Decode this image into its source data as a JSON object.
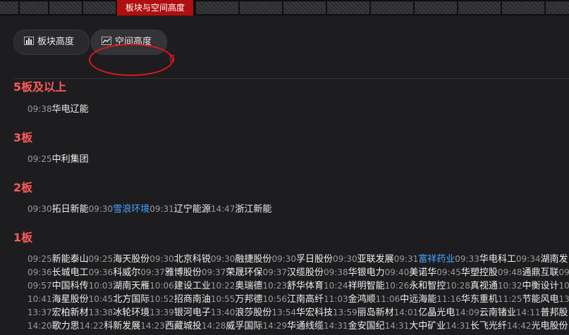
{
  "tabbar": {
    "active_tab": "板块与空间高度"
  },
  "buttons": {
    "sector_height": "板块高度",
    "space_height": "空间高度"
  },
  "colors": {
    "accent_red": "#b00f0f",
    "board_heading": "#ff5a5a",
    "link_blue": "#4aa3ff"
  },
  "icons": {
    "sector_height": "bar-chart-icon",
    "space_height": "line-chart-icon"
  },
  "sections": [
    {
      "title": "5板及以上",
      "rows": [
        [
          {
            "time": "09:38",
            "name": "华电辽能"
          }
        ]
      ]
    },
    {
      "title": "3板",
      "rows": [
        [
          {
            "time": "09:25",
            "name": "中利集团"
          }
        ]
      ]
    },
    {
      "title": "2板",
      "rows": [
        [
          {
            "time": "09:30",
            "name": "拓日新能"
          },
          {
            "time": "09:30",
            "name": "雪浪环境",
            "blue": true
          },
          {
            "time": "09:31",
            "name": "辽宁能源"
          },
          {
            "time": "14:47",
            "name": "浙江新能"
          }
        ]
      ]
    },
    {
      "title": "1板",
      "rows": [
        [
          {
            "time": "09:25",
            "name": "新能泰山"
          },
          {
            "time": "09:25",
            "name": "海天股份"
          },
          {
            "time": "09:30",
            "name": "北京科锐"
          },
          {
            "time": "09:30",
            "name": "融捷股份"
          },
          {
            "time": "09:30",
            "name": "孚日股份"
          },
          {
            "time": "09:30",
            "name": "亚联发展"
          },
          {
            "time": "09:31",
            "name": "富祥药业",
            "blue": true
          },
          {
            "time": "09:33",
            "name": "华电科工"
          },
          {
            "time": "09:34",
            "name": "湖南发"
          }
        ],
        [
          {
            "time": "09:36",
            "name": "长城电工"
          },
          {
            "time": "09:36",
            "name": "科威尔"
          },
          {
            "time": "09:37",
            "name": "雅博股份"
          },
          {
            "time": "09:37",
            "name": "荣晟环保"
          },
          {
            "time": "09:37",
            "name": "汉缆股份"
          },
          {
            "time": "09:38",
            "name": "华银电力"
          },
          {
            "time": "09:40",
            "name": "美诺华"
          },
          {
            "time": "09:45",
            "name": "华塑控股"
          },
          {
            "time": "09:48",
            "name": "通鼎互联"
          },
          {
            "time": "09",
            "name": ""
          }
        ],
        [
          {
            "time": "09:57",
            "name": "中国科传"
          },
          {
            "time": "10:03",
            "name": "湖南天雁"
          },
          {
            "time": "10:06",
            "name": "建设工业"
          },
          {
            "time": "10:22",
            "name": "奥瑞德"
          },
          {
            "time": "10:23",
            "name": "舒华体育"
          },
          {
            "time": "10:24",
            "name": "祥明智能"
          },
          {
            "time": "10:26",
            "name": "永和智控"
          },
          {
            "time": "10:28",
            "name": "真视通"
          },
          {
            "time": "10:32",
            "name": "中衡设计"
          },
          {
            "time": "10",
            "name": ""
          }
        ],
        [
          {
            "time": "10:41",
            "name": "海星股份"
          },
          {
            "time": "10:45",
            "name": "北方国际"
          },
          {
            "time": "10:52",
            "name": "招商南油"
          },
          {
            "time": "10:55",
            "name": "万邦德"
          },
          {
            "time": "10:56",
            "name": "江南高纤"
          },
          {
            "time": "11:03",
            "name": "金鸿顺"
          },
          {
            "time": "11:06",
            "name": "中远海能"
          },
          {
            "time": "11:16",
            "name": "华东重机"
          },
          {
            "time": "11:25",
            "name": "节能风电"
          },
          {
            "time": "13",
            "name": ""
          }
        ],
        [
          {
            "time": "13:37",
            "name": "宏柏新材"
          },
          {
            "time": "13:38",
            "name": "冰轮环境"
          },
          {
            "time": "13:39",
            "name": "银河电子"
          },
          {
            "time": "13:40",
            "name": "浪莎股份"
          },
          {
            "time": "13:54",
            "name": "华宏科技"
          },
          {
            "time": "13:59",
            "name": "丽岛新材"
          },
          {
            "time": "14:01",
            "name": "亿晶光电"
          },
          {
            "time": "14:09",
            "name": "云南锗业"
          },
          {
            "time": "14:11",
            "name": "普邦股"
          }
        ],
        [
          {
            "time": "14:20",
            "name": "歌力思"
          },
          {
            "time": "14:22",
            "name": "科新发展"
          },
          {
            "time": "14:23",
            "name": "西藏城投"
          },
          {
            "time": "14:28",
            "name": "威孚国际"
          },
          {
            "time": "14:29",
            "name": "华通线缆"
          },
          {
            "time": "14:31",
            "name": "金安国纪"
          },
          {
            "time": "14:31",
            "name": "大中矿业"
          },
          {
            "time": "14:31",
            "name": "长飞光纤"
          },
          {
            "time": "14:42",
            "name": "光电股份"
          }
        ]
      ]
    }
  ]
}
